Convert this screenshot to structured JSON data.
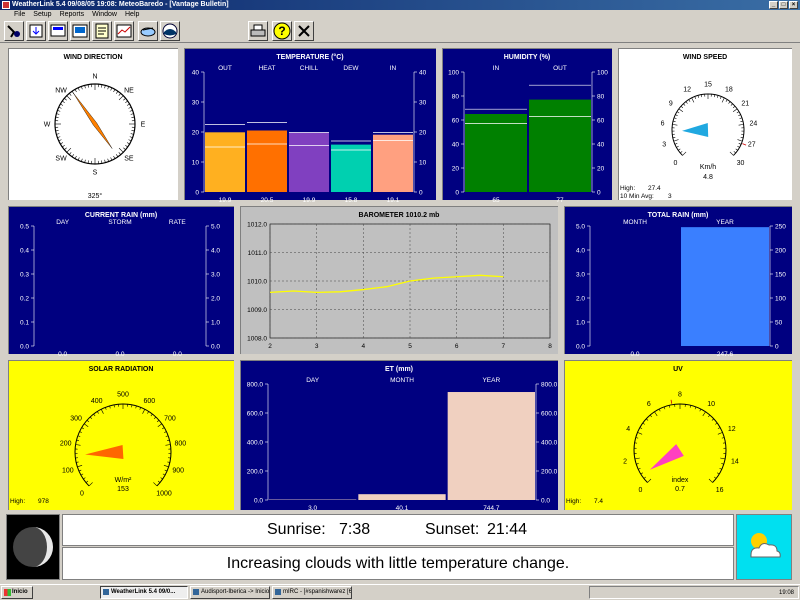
{
  "window": {
    "title": "WeatherLink 5.4  09/08/05  19:08:  MeteoBaredo - [Vantage Bulletin]"
  },
  "menu": [
    "File",
    "Setup",
    "Reports",
    "Window",
    "Help"
  ],
  "toolbar": {
    "icons": [
      "connect-icon",
      "download-icon",
      "bulletin-icon",
      "summary-icon",
      "noaa-report-icon",
      "strip-chart-icon",
      "internet-icon",
      "noaa-logo-icon",
      "print-icon",
      "help-icon",
      "close-icon"
    ]
  },
  "wind_direction": {
    "title": "WIND DIRECTION",
    "labels": [
      "N",
      "NE",
      "E",
      "SE",
      "S",
      "SW",
      "W",
      "NW"
    ],
    "value_label": "325°",
    "direction_deg": 325
  },
  "temperature": {
    "title": "TEMPERATURE  (°C)",
    "categories": [
      "OUT",
      "HEAT",
      "CHILL",
      "DEW",
      "IN"
    ],
    "values": [
      19.9,
      20.5,
      19.9,
      15.8,
      19.1
    ],
    "value_labels": [
      "19.9",
      "20.5",
      "19.9",
      "15.8",
      "19.1"
    ],
    "ticks": [
      "40",
      "30",
      "20",
      "10",
      "0"
    ],
    "colors": [
      "#ffb020",
      "#ff7000",
      "#8040c0",
      "#00d0b0",
      "#ffa080"
    ]
  },
  "humidity": {
    "title": "HUMIDITY  (%)",
    "categories": [
      "IN",
      "OUT"
    ],
    "values": [
      65,
      77
    ],
    "value_labels": [
      "65",
      "77"
    ],
    "ticks": [
      "100",
      "80",
      "60",
      "40",
      "20",
      "0"
    ],
    "color": "#008000"
  },
  "wind_speed": {
    "title": "WIND SPEED",
    "ticks": [
      "0",
      "3",
      "6",
      "9",
      "12",
      "15",
      "18",
      "21",
      "24",
      "27",
      "30"
    ],
    "unit": "Km/h",
    "value": "4.8",
    "high_label": "High:",
    "high_value": "27.4",
    "avg_label": "10 Min Avg:",
    "avg_value": "3"
  },
  "current_rain": {
    "title": "CURRENT RAIN  (mm)",
    "categories": [
      "DAY",
      "STORM",
      "RATE"
    ],
    "value_labels": [
      "0.0",
      "0.0",
      "0.0"
    ],
    "left_ticks": [
      "0.5",
      "0.4",
      "0.3",
      "0.2",
      "0.1",
      "0.0"
    ],
    "right_ticks": [
      "5.0",
      "4.0",
      "3.0",
      "2.0",
      "1.0",
      "0.0"
    ]
  },
  "barometer": {
    "title": "BAROMETER 1010.2 mb",
    "y_ticks": [
      "1012.0",
      "1011.0",
      "1010.0",
      "1009.0",
      "1008.0"
    ],
    "x_ticks": [
      "2",
      "3",
      "4",
      "5",
      "6",
      "7",
      "8"
    ]
  },
  "total_rain": {
    "title": "TOTAL RAIN  (mm)",
    "categories": [
      "MONTH",
      "YEAR"
    ],
    "values": [
      0.0,
      247.6
    ],
    "value_labels": [
      "0.0",
      "247.6"
    ],
    "left_ticks": [
      "5.0",
      "4.0",
      "3.0",
      "2.0",
      "1.0",
      "0.0"
    ],
    "right_ticks": [
      "250",
      "200",
      "150",
      "100",
      "50",
      "0"
    ],
    "color": "#3a7fff"
  },
  "solar_radiation": {
    "title": "SOLAR RADIATION",
    "ticks": [
      "0",
      "100",
      "200",
      "300",
      "400",
      "500",
      "600",
      "700",
      "800",
      "900",
      "1000"
    ],
    "unit": "W/m²",
    "value": "153",
    "high_label": "High:",
    "high_value": "978"
  },
  "et": {
    "title": "ET  (mm)",
    "categories": [
      "DAY",
      "MONTH",
      "YEAR"
    ],
    "values": [
      3.0,
      40.1,
      744.7
    ],
    "value_labels": [
      "3.0",
      "40.1",
      "744.7"
    ],
    "ticks": [
      "800.0",
      "600.0",
      "400.0",
      "200.0",
      "0.0"
    ],
    "color": "#f0d0c0"
  },
  "uv": {
    "title": "UV",
    "ticks": [
      "0",
      "2",
      "4",
      "6",
      "8",
      "10",
      "12",
      "14",
      "16"
    ],
    "unit": "index",
    "value": "0.7",
    "high_label": "High:",
    "high_value": "7.4"
  },
  "status": {
    "sunrise_label": "Sunrise:",
    "sunrise": "7:38",
    "sunset_label": "Sunset:",
    "sunset": "21:44",
    "forecast": "Increasing clouds with little temperature change."
  },
  "taskbar": {
    "start": "Inicio",
    "tasks": [
      "WeatherLink 5.4  09/0...",
      "Audisport-Iberica -> Inicio...",
      "mIRC - [#spanishwarez [6..."
    ],
    "clock": "19:08"
  }
}
